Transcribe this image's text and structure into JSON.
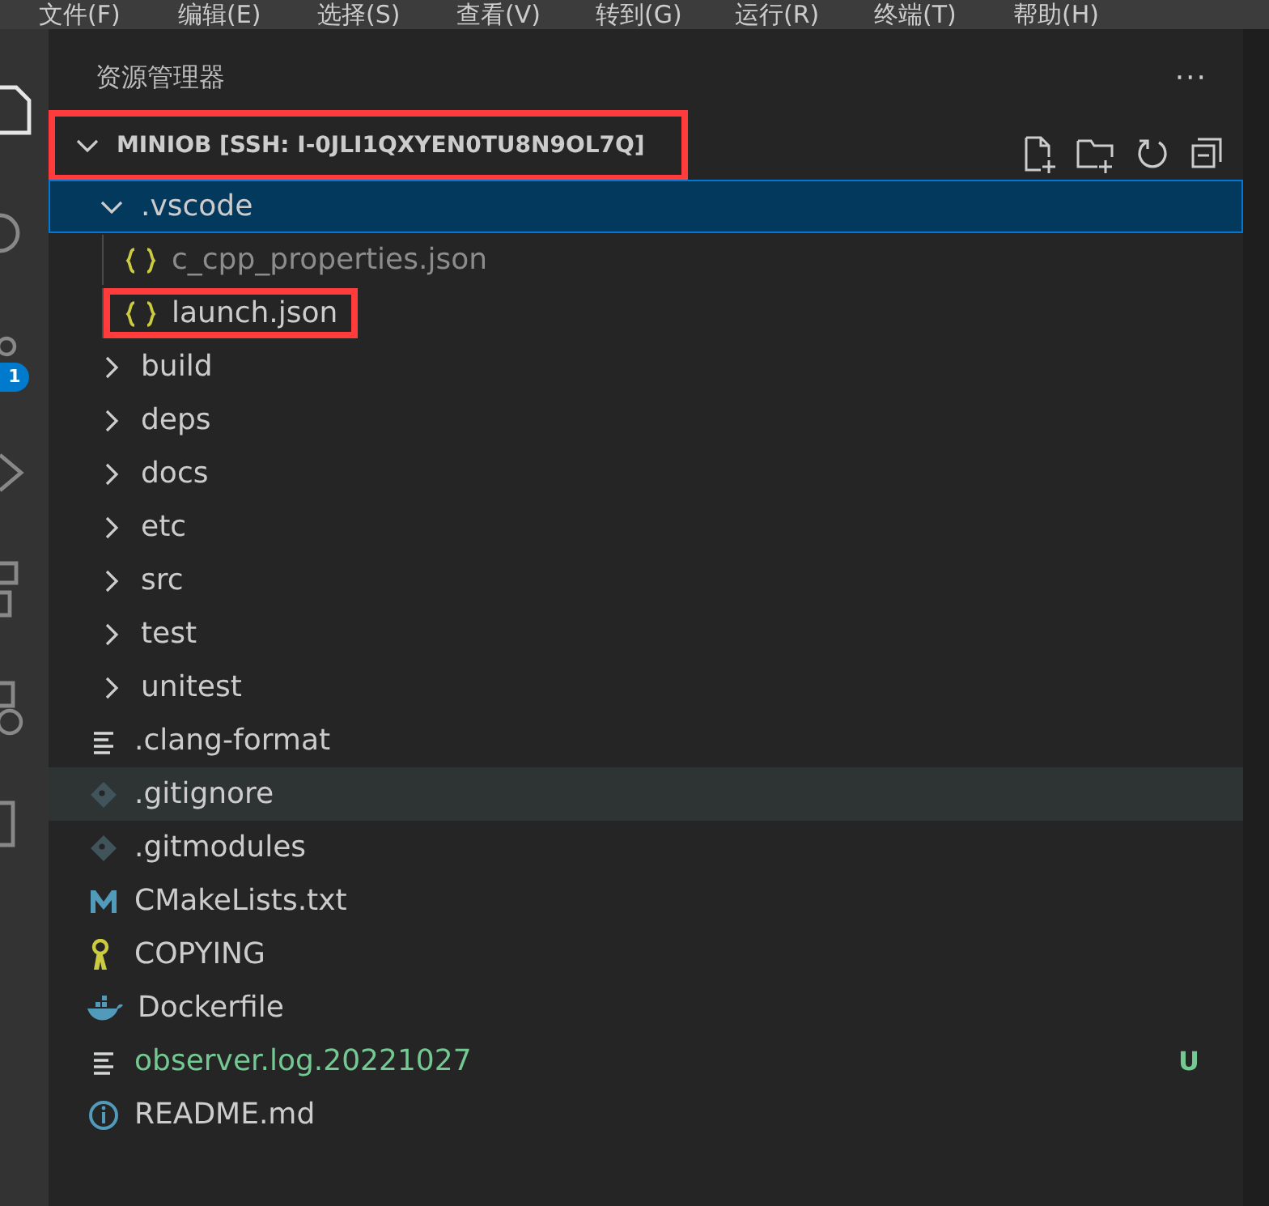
{
  "menu_bar": [
    "文件(F)",
    "编辑(E)",
    "选择(S)",
    "查看(V)",
    "转到(G)",
    "运行(R)",
    "终端(T)",
    "帮助(H)"
  ],
  "activity_bar": {
    "badge": "1"
  },
  "explorer": {
    "title": "资源管理器",
    "more": "···",
    "root": {
      "label": "MINIOB [SSH: I-0JLI1QXYEN0TU8N9OL7Q]",
      "expanded": true,
      "highlighted": true,
      "children": [
        {
          "label": ".vscode",
          "kind": "folder",
          "expanded": true,
          "selected": true,
          "hovered": false,
          "ignored": false,
          "highlighted": false,
          "children": [
            {
              "label": "c_cpp_properties.json",
              "kind": "json",
              "selected": false,
              "hovered": false,
              "ignored": true,
              "highlighted": false
            },
            {
              "label": "launch.json",
              "kind": "json",
              "selected": false,
              "hovered": false,
              "ignored": false,
              "highlighted": true
            }
          ]
        },
        {
          "label": "build",
          "kind": "folder",
          "expanded": false,
          "selected": false,
          "hovered": false,
          "ignored": false,
          "highlighted": false
        },
        {
          "label": "deps",
          "kind": "folder",
          "expanded": false,
          "selected": false,
          "hovered": false,
          "ignored": false,
          "highlighted": false
        },
        {
          "label": "docs",
          "kind": "folder",
          "expanded": false,
          "selected": false,
          "hovered": false,
          "ignored": false,
          "highlighted": false
        },
        {
          "label": "etc",
          "kind": "folder",
          "expanded": false,
          "selected": false,
          "hovered": false,
          "ignored": false,
          "highlighted": false
        },
        {
          "label": "src",
          "kind": "folder",
          "expanded": false,
          "selected": false,
          "hovered": false,
          "ignored": false,
          "highlighted": false
        },
        {
          "label": "test",
          "kind": "folder",
          "expanded": false,
          "selected": false,
          "hovered": false,
          "ignored": false,
          "highlighted": false
        },
        {
          "label": "unitest",
          "kind": "folder",
          "expanded": false,
          "selected": false,
          "hovered": false,
          "ignored": false,
          "highlighted": false
        },
        {
          "label": ".clang-format",
          "kind": "text",
          "selected": false,
          "hovered": false,
          "ignored": false,
          "highlighted": false
        },
        {
          "label": ".gitignore",
          "kind": "git",
          "selected": false,
          "hovered": true,
          "ignored": false,
          "highlighted": false
        },
        {
          "label": ".gitmodules",
          "kind": "git",
          "selected": false,
          "hovered": false,
          "ignored": false,
          "highlighted": false
        },
        {
          "label": "CMakeLists.txt",
          "kind": "cmake",
          "selected": false,
          "hovered": false,
          "ignored": false,
          "highlighted": false
        },
        {
          "label": "COPYING",
          "kind": "license",
          "selected": false,
          "hovered": false,
          "ignored": false,
          "highlighted": false
        },
        {
          "label": "Dockerfile",
          "kind": "docker",
          "selected": false,
          "hovered": false,
          "ignored": false,
          "highlighted": false
        },
        {
          "label": "observer.log.20221027",
          "kind": "text",
          "status": "U",
          "selected": false,
          "hovered": false,
          "ignored": false,
          "highlighted": false
        },
        {
          "label": "README.md",
          "kind": "info",
          "selected": false,
          "hovered": false,
          "ignored": false,
          "highlighted": false
        }
      ]
    }
  }
}
